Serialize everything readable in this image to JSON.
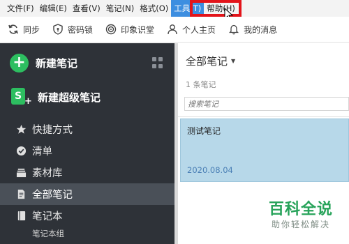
{
  "menubar": {
    "items": [
      {
        "label": "文件(F)"
      },
      {
        "label": "编辑(E)"
      },
      {
        "label": "查看(V)"
      },
      {
        "label": "笔记(N)"
      },
      {
        "label": "格式(O)"
      },
      {
        "label": "工具(T)",
        "active": true
      },
      {
        "label": "帮助(H)"
      }
    ]
  },
  "toolbar": {
    "items": [
      {
        "label": "同步",
        "icon": "sync-icon"
      },
      {
        "label": "密码锁",
        "icon": "shield-lock-icon"
      },
      {
        "label": "印象识堂",
        "icon": "target-icon"
      },
      {
        "label": "个人主页",
        "icon": "person-icon"
      },
      {
        "label": "我的消息",
        "icon": "bell-icon"
      }
    ]
  },
  "sidebar": {
    "new_note": "新建笔记",
    "new_super_note": "新建超级笔记",
    "super_icon_letter": "S",
    "items": [
      {
        "label": "快捷方式",
        "icon": "star-icon"
      },
      {
        "label": "清单",
        "icon": "check-circle-icon"
      },
      {
        "label": "素材库",
        "icon": "stack-icon"
      },
      {
        "label": "全部笔记",
        "icon": "note-icon",
        "selected": true
      },
      {
        "label": "笔记本",
        "icon": "notebook-icon"
      }
    ],
    "sub_item": "笔记本组"
  },
  "notelist": {
    "title": "全部笔记",
    "count": "1 条笔记",
    "search_placeholder": "搜索笔记",
    "notes": [
      {
        "title": "测试笔记",
        "date": "2020.08.04"
      }
    ]
  },
  "watermark": {
    "title": "百科全说",
    "subtitle": "助你轻松解决"
  },
  "colors": {
    "accent_green": "#2dbe60",
    "sidebar_bg": "#2e3238",
    "menu_active": "#3d8ee0",
    "highlight_red": "#e3141a",
    "note_selected": "#b7d8e9"
  }
}
